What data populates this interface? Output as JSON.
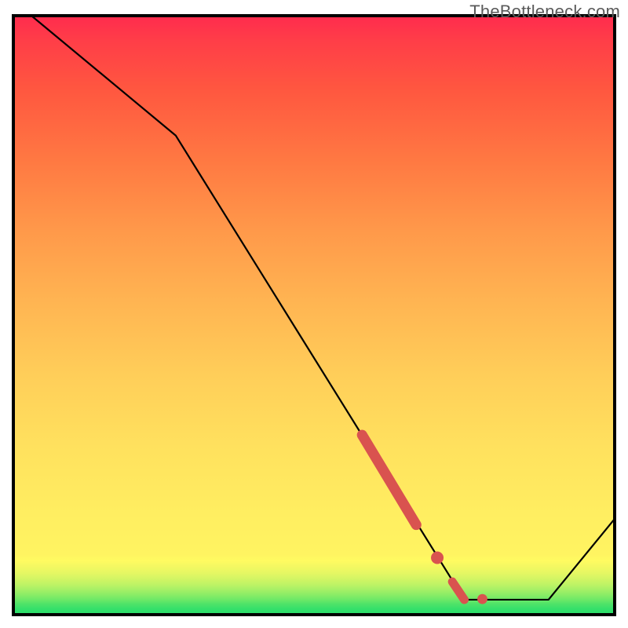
{
  "watermark": "TheBottleneck.com",
  "chart_data": {
    "type": "line",
    "title": "",
    "xlabel": "",
    "ylabel": "",
    "xlim": [
      0,
      100
    ],
    "ylim": [
      0,
      100
    ],
    "x": [
      3,
      27,
      75,
      82,
      89,
      100
    ],
    "y": [
      100,
      80,
      2.5,
      2.5,
      2.5,
      16
    ],
    "markers": [
      {
        "shape": "line",
        "x1": 58,
        "y1": 30,
        "x2": 67,
        "y2": 15,
        "thickness": 6
      },
      {
        "shape": "dot",
        "x": 70.5,
        "y": 9.5,
        "r": 5
      },
      {
        "shape": "line",
        "x1": 73,
        "y1": 5.5,
        "x2": 75,
        "y2": 2.5,
        "thickness": 5
      },
      {
        "shape": "dot",
        "x": 78,
        "y": 2.6,
        "r": 4
      }
    ],
    "marker_color": "#d9534f",
    "heatmap_bands": [
      {
        "y": 0.0,
        "color": "#27dd6b"
      },
      {
        "y": 1.0,
        "color": "#36e06a"
      },
      {
        "y": 1.8,
        "color": "#4fe368"
      },
      {
        "y": 2.6,
        "color": "#71e967"
      },
      {
        "y": 3.4,
        "color": "#8ded66"
      },
      {
        "y": 4.2,
        "color": "#a7f066"
      },
      {
        "y": 5.0,
        "color": "#bdf365"
      },
      {
        "y": 6.0,
        "color": "#d3f564"
      },
      {
        "y": 7.0,
        "color": "#e6f763"
      },
      {
        "y": 8.0,
        "color": "#f3f862"
      },
      {
        "y": 9.0,
        "color": "#fffb61"
      },
      {
        "y": 10.0,
        "color": "#fff461"
      },
      {
        "y": 16.0,
        "color": "#ffef61"
      },
      {
        "y": 28.0,
        "color": "#ffe15e"
      },
      {
        "y": 40.0,
        "color": "#ffce59"
      },
      {
        "y": 52.0,
        "color": "#ffb552"
      },
      {
        "y": 64.0,
        "color": "#ff994a"
      },
      {
        "y": 76.0,
        "color": "#ff7842"
      },
      {
        "y": 88.0,
        "color": "#ff5640"
      },
      {
        "y": 96.0,
        "color": "#ff3d48"
      },
      {
        "y": 100.0,
        "color": "#ff2b4e"
      }
    ]
  },
  "colors": {
    "plot_border": "#000000",
    "line": "#000000",
    "marker": "#d9534f"
  }
}
